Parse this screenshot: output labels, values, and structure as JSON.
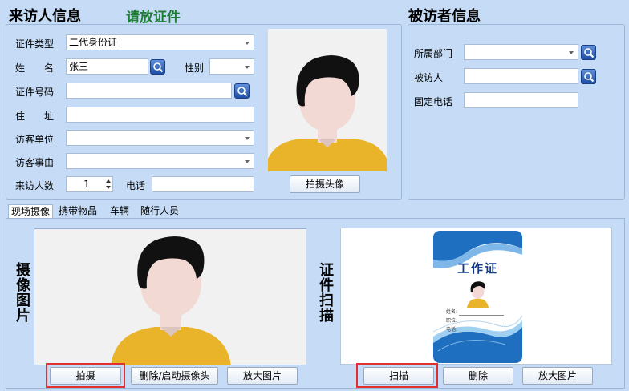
{
  "visitor": {
    "title": "来访人信息",
    "hint": "请放证件",
    "id_type_label": "证件类型",
    "id_type_value": "二代身份证",
    "name_label": "姓　　名",
    "name_value": "张三",
    "gender_label": "性别",
    "gender_value": "",
    "id_number_label": "证件号码",
    "id_number_value": "",
    "address_label": "住　　址",
    "address_value": "",
    "company_label": "访客单位",
    "company_value": "",
    "reason_label": "访客事由",
    "reason_value": "",
    "count_label": "来访人数",
    "count_value": "1",
    "phone_label": "电话",
    "phone_value": "",
    "capture_head_button": "拍摄头像"
  },
  "host": {
    "title": "被访者信息",
    "dept_label": "所属部门",
    "dept_value": "",
    "person_label": "被访人",
    "person_value": "",
    "landline_label": "固定电话",
    "landline_value": ""
  },
  "tabs": [
    {
      "label": "现场摄像",
      "active": true
    },
    {
      "label": "携带物品",
      "active": false
    },
    {
      "label": "车辆",
      "active": false
    },
    {
      "label": "随行人员",
      "active": false
    }
  ],
  "camera": {
    "side_label": "摄像图片",
    "shoot_button": "拍摄",
    "toggle_button": "删除/启动摄像头",
    "enlarge_button": "放大图片"
  },
  "scan": {
    "side_label": "证件扫描",
    "card_title": "工作证",
    "card_name_label": "姓名:",
    "card_position_label": "职位:",
    "card_phone_label": "电话:",
    "scan_button": "扫描",
    "delete_button": "删除",
    "enlarge_button": "放大图片"
  },
  "colors": {
    "background": "#c6dcf6",
    "hint_green": "#1e7d34",
    "highlight_red": "#e03030",
    "avatar_hair": "#111111",
    "avatar_skin": "#f2d9d3",
    "avatar_shirt": "#e9b32a"
  }
}
